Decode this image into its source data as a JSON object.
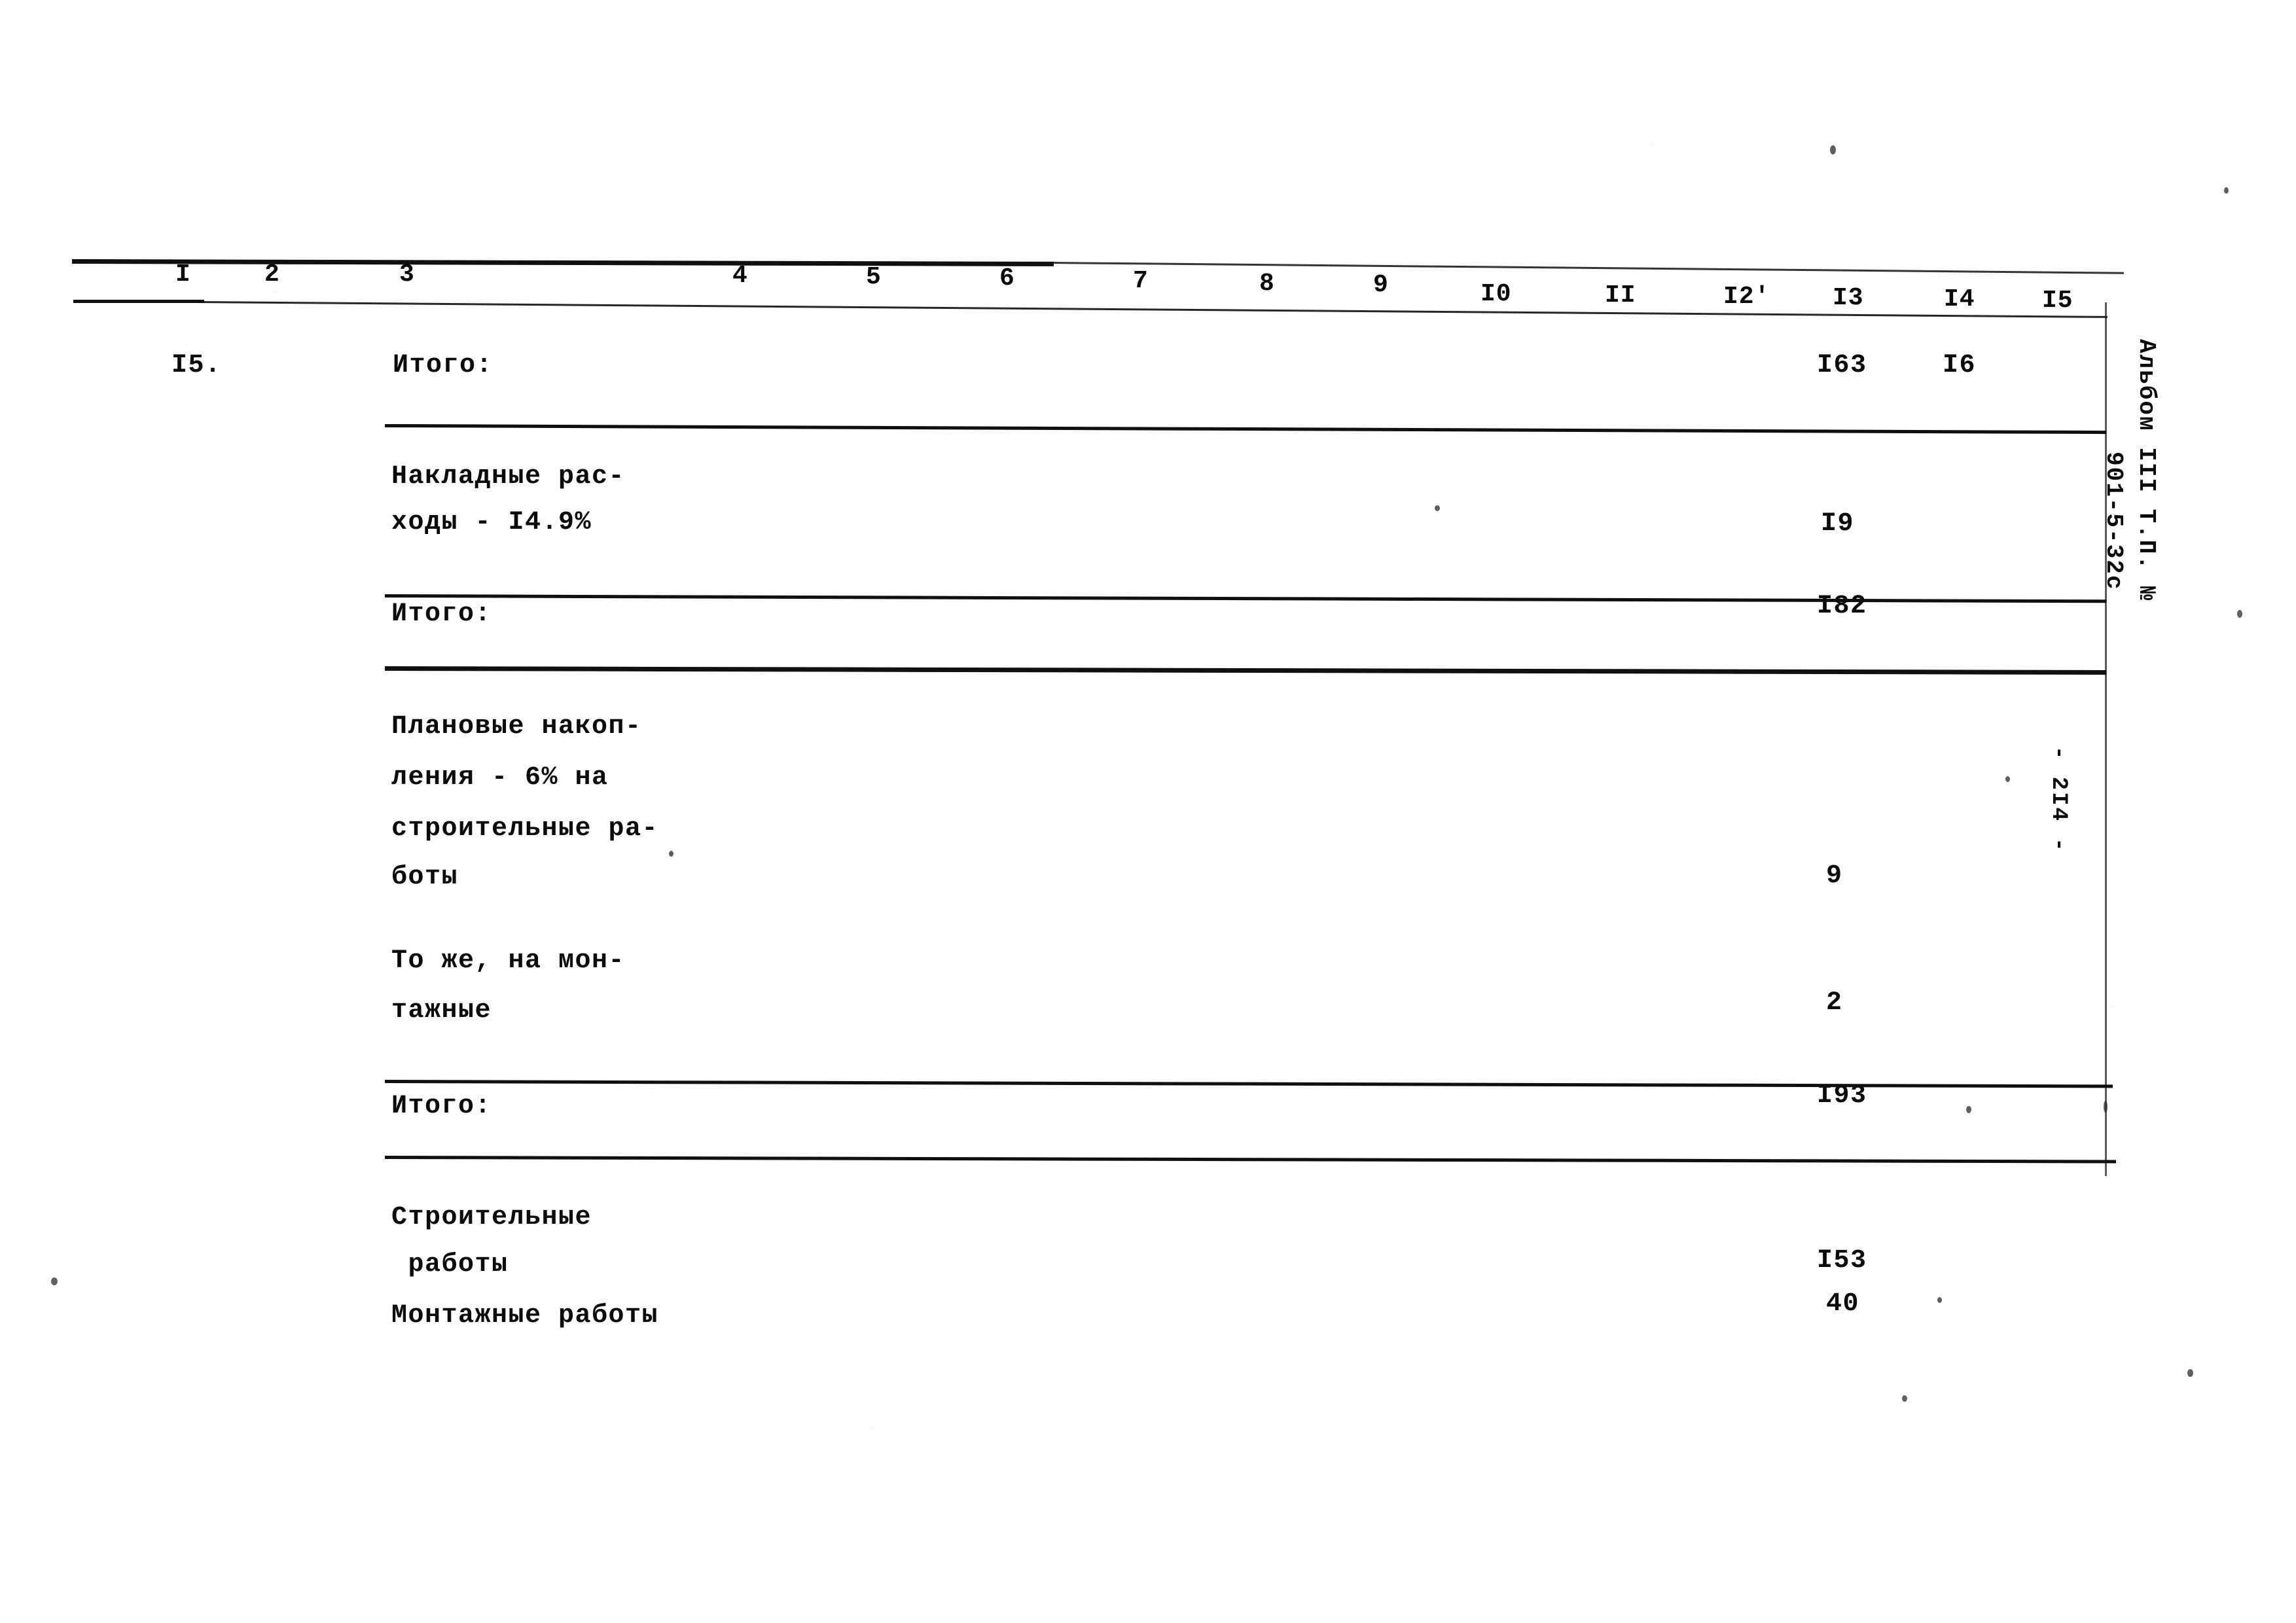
{
  "document": {
    "kind": "scanned-estimate-table",
    "page_number_mark": "- 2I4 -",
    "margin_note_line1": "Альбом III Т.П. №",
    "margin_note_line2": "901-5-32с"
  },
  "table": {
    "column_numbers": [
      "I",
      "2",
      "3",
      "4",
      "5",
      "6",
      "7",
      "8",
      "9",
      "I0",
      "II",
      "I2'",
      "I3",
      "I4",
      "I5"
    ],
    "rows": [
      {
        "id": "itogo-1",
        "row_number": "I5.",
        "label_lines": [
          "Итого:"
        ],
        "col13": "I63",
        "col14": "I6"
      },
      {
        "id": "nakladnye",
        "row_number": "",
        "label_lines": [
          "Накладные рас-",
          "ходы - I4.9%"
        ],
        "col13": "I9",
        "col14": ""
      },
      {
        "id": "itogo-2",
        "row_number": "",
        "label_lines": [
          "Итого:"
        ],
        "col13": "I82",
        "col14": ""
      },
      {
        "id": "planovye",
        "row_number": "",
        "label_lines": [
          "Плановые накоп-",
          "ления - 6% на",
          "строительные ра-",
          "боты"
        ],
        "col13": "9",
        "col14": ""
      },
      {
        "id": "tozhe-montazh",
        "row_number": "",
        "label_lines": [
          "То же, на мон-",
          "тажные"
        ],
        "col13": "2",
        "col14": ""
      },
      {
        "id": "itogo-3",
        "row_number": "",
        "label_lines": [
          "Итого:"
        ],
        "col13": "I93",
        "col14": ""
      },
      {
        "id": "stroitelnye",
        "row_number": "",
        "label_lines": [
          "Строительные",
          " работы"
        ],
        "col13": "I53",
        "col14": ""
      },
      {
        "id": "montazhnye",
        "row_number": "",
        "label_lines": [
          "Монтажные работы"
        ],
        "col13": "40",
        "col14": ""
      }
    ]
  }
}
